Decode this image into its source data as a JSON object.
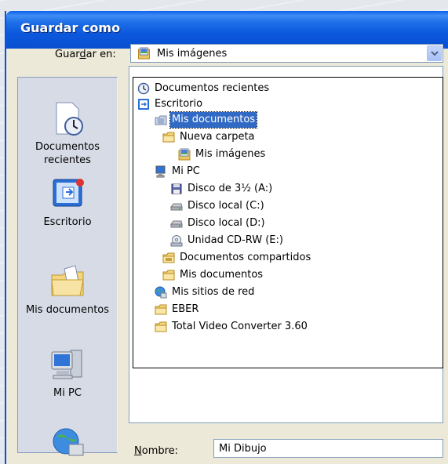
{
  "dialog": {
    "title": "Guardar como",
    "look_in_label_pre": "Guar",
    "look_in_label_key": "d",
    "look_in_label_post": "ar en:",
    "look_in_value": "Mis imágenes"
  },
  "places_bar": [
    {
      "label_line1": "Documentos",
      "label_line2": "recientes",
      "icon": "recent-documents-icon"
    },
    {
      "label_line1": "Escritorio",
      "label_line2": "",
      "icon": "desktop-icon"
    },
    {
      "label_line1": "Mis documentos",
      "label_line2": "",
      "icon": "my-documents-icon"
    },
    {
      "label_line1": "Mi PC",
      "label_line2": "",
      "icon": "my-computer-icon"
    },
    {
      "label_line1": "",
      "label_line2": "",
      "icon": "network-places-icon"
    }
  ],
  "dropdown_items": [
    {
      "label": "Documentos recientes",
      "icon": "recent-documents-icon"
    },
    {
      "label": "Escritorio",
      "icon": "desktop-icon"
    },
    {
      "label": "Mis documentos",
      "icon": "my-documents-icon",
      "selected": true
    },
    {
      "label": "Nueva carpeta",
      "icon": "folder-icon"
    },
    {
      "label": "Mis imágenes",
      "icon": "my-pictures-icon"
    },
    {
      "label": "Mi PC",
      "icon": "my-computer-icon"
    },
    {
      "label": "Disco de 3½ (A:)",
      "icon": "floppy-drive-icon"
    },
    {
      "label": "Disco local (C:)",
      "icon": "hard-drive-icon"
    },
    {
      "label": "Disco local (D:)",
      "icon": "hard-drive-icon"
    },
    {
      "label": "Unidad CD-RW (E:)",
      "icon": "cd-drive-icon"
    },
    {
      "label": "Documentos compartidos",
      "icon": "shared-folder-icon"
    },
    {
      "label": "Mis documentos",
      "icon": "folder-icon"
    },
    {
      "label": "Mis sitios de red",
      "icon": "network-places-icon"
    },
    {
      "label": "EBER",
      "icon": "folder-icon"
    },
    {
      "label": "Total Video Converter 3.60",
      "icon": "folder-icon"
    }
  ],
  "filename": {
    "label_key": "N",
    "label_rest": "ombre:",
    "value": "Mi Dibujo"
  }
}
